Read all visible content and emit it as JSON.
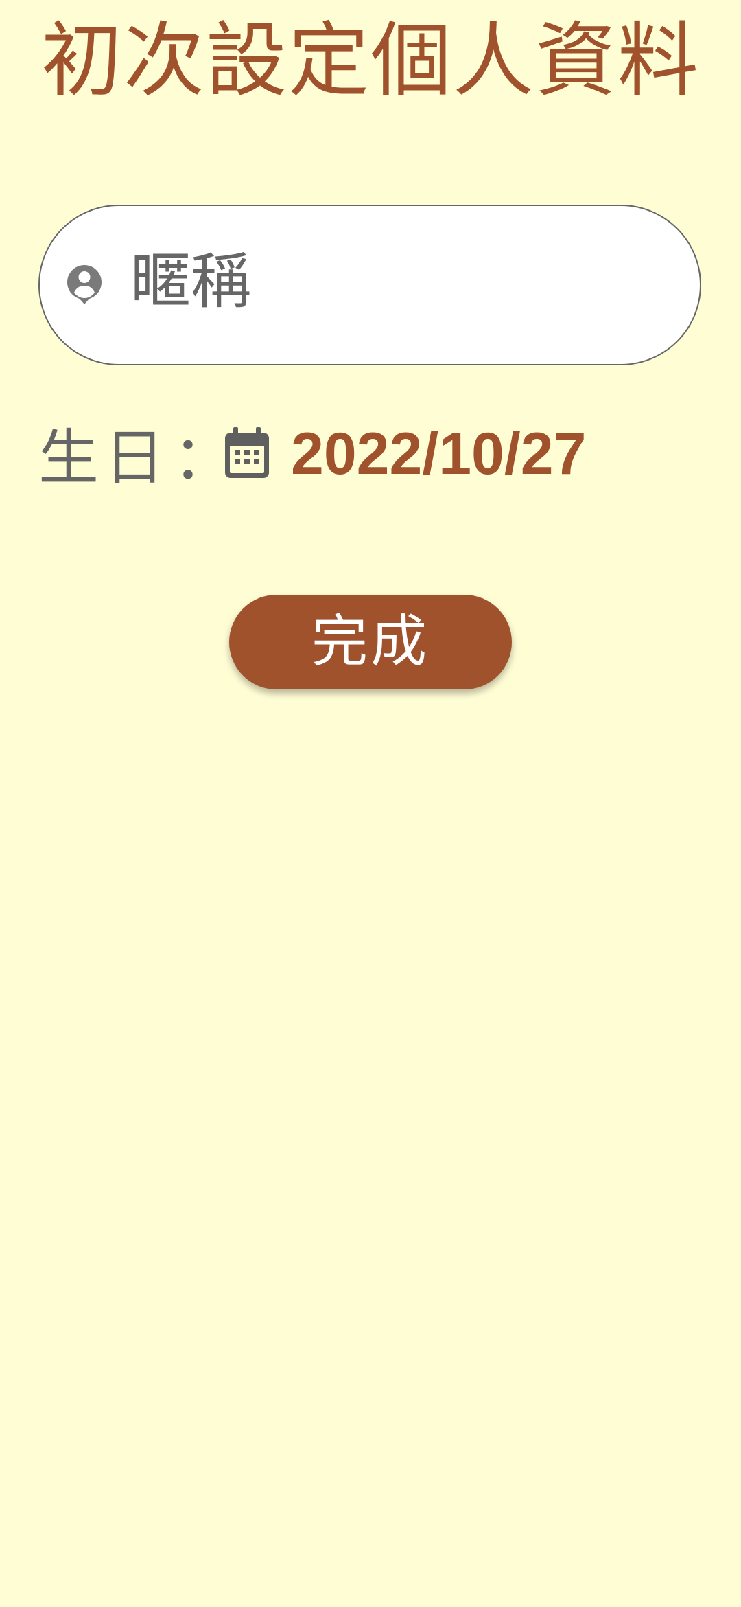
{
  "header": {
    "title": "初次設定個人資料"
  },
  "nickname": {
    "icon": "account-circle-icon",
    "placeholder": "暱稱"
  },
  "birthday": {
    "label": "生日",
    "colon": "：",
    "icon": "calendar-icon",
    "value": "2022/10/27"
  },
  "actions": {
    "done_label": "完成"
  },
  "colors": {
    "background": "#FFFDD4",
    "accent": "#A0522D",
    "text_secondary": "#666666",
    "field_background": "#FFFFFF",
    "button_text": "#FFFFFF"
  }
}
